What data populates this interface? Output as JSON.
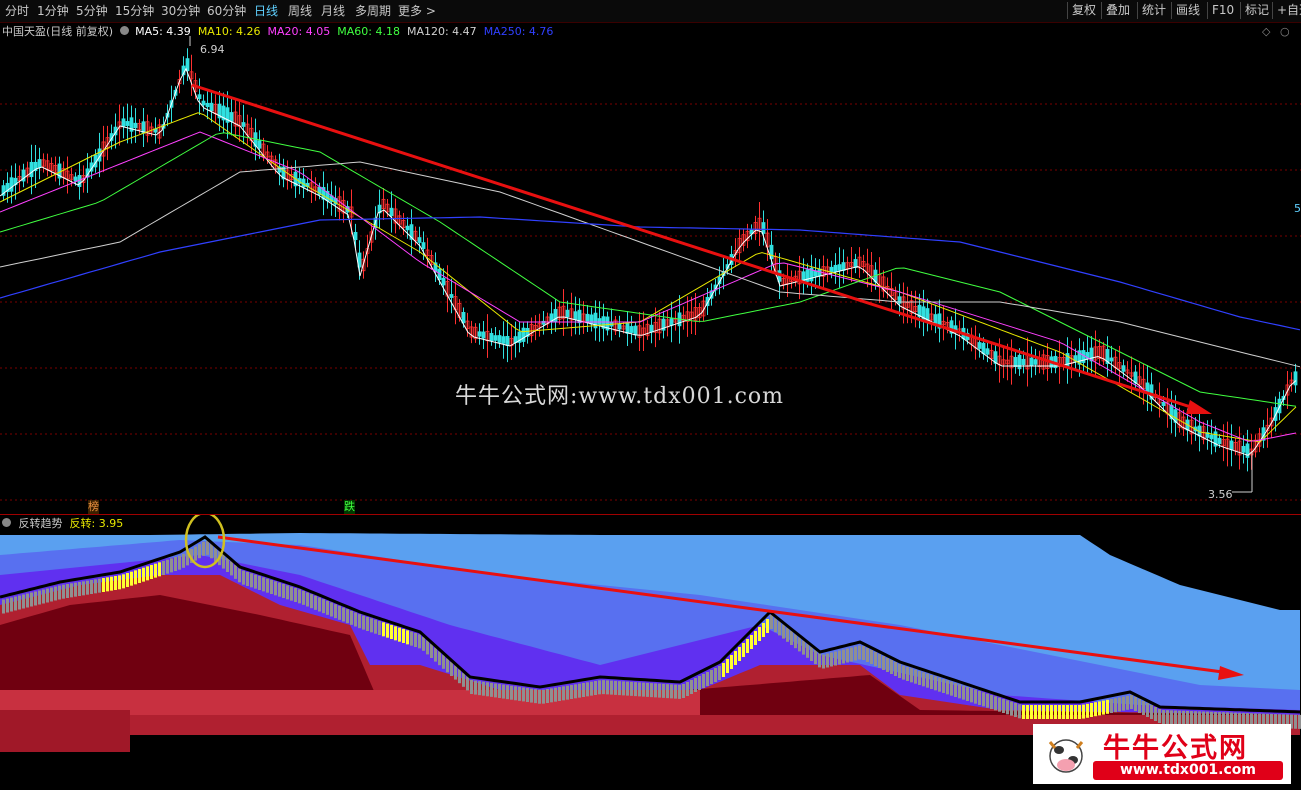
{
  "toolbar": {
    "periods": [
      "分时",
      "1分钟",
      "5分钟",
      "15分钟",
      "30分钟",
      "60分钟",
      "日线",
      "周线",
      "月线",
      "多周期",
      "更多 >"
    ],
    "active_period": "日线",
    "right_buttons": [
      "复权",
      "叠加",
      "统计",
      "画线",
      "F10",
      "标记",
      "+自选"
    ]
  },
  "main": {
    "stock_title": "中国天盈(日线 前复权)",
    "ma_legend": [
      {
        "label": "MA5: 4.39",
        "color": "#ffffff"
      },
      {
        "label": "MA10: 4.26",
        "color": "#e8e800"
      },
      {
        "label": "MA20: 4.05",
        "color": "#ff40ff"
      },
      {
        "label": "MA60: 4.18",
        "color": "#40ff40"
      },
      {
        "label": "MA120: 4.47",
        "color": "#d0d0d0"
      },
      {
        "label": "MA250: 4.76",
        "color": "#3040ff"
      }
    ],
    "high_label": "6.94",
    "low_label": "3.56",
    "right_edge_label": "5",
    "marker_bang": "榜",
    "marker_die": "跌"
  },
  "sub": {
    "indicator_name": "反转趋势",
    "indicator_value": "反转: 3.95"
  },
  "watermark": "牛牛公式网:www.tdx001.com",
  "logo": {
    "title": "牛牛公式网",
    "url": "www.tdx001.com"
  },
  "colors": {
    "background": "#000000",
    "grid": "#7a0000",
    "trend_arrow": "#e81010",
    "active_tab": "#5fd0ff"
  }
}
